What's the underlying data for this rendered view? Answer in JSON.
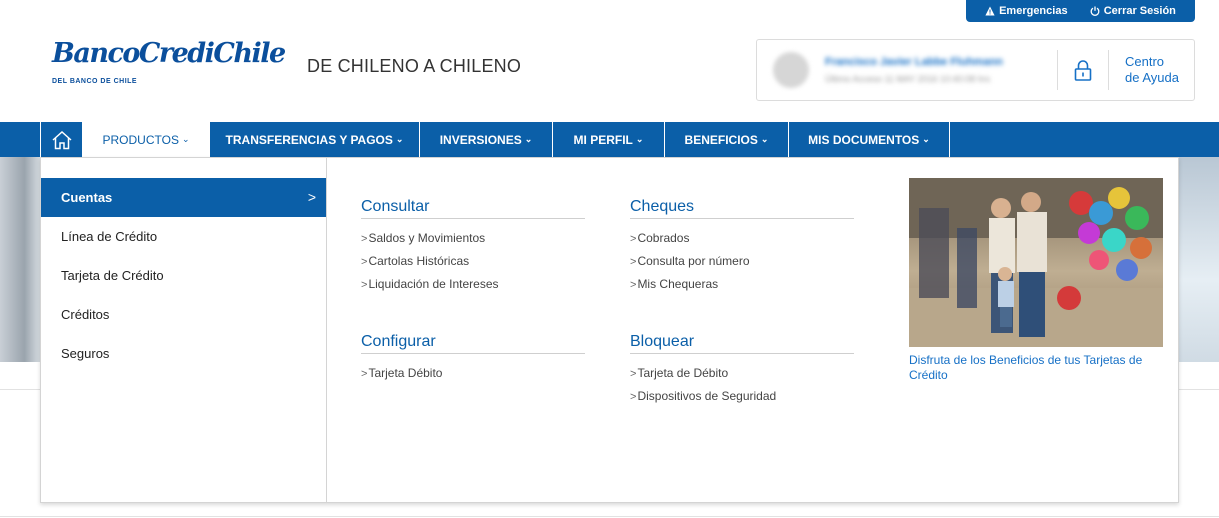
{
  "utility_bar": {
    "emergencias": "Emergencias",
    "cerrar_sesion": "Cerrar Sesión"
  },
  "logo": {
    "name": "BancoCrediChile",
    "sub": "DEL BANCO DE CHILE"
  },
  "tagline": "DE CHILENO A CHILENO",
  "user": {
    "name": "Francisco Javier Labbe Fluhmann",
    "last_access": "Último Acceso 11 MAY 2016 10:40:08 hrs"
  },
  "help": {
    "line1": "Centro",
    "line2": "de Ayuda"
  },
  "nav": {
    "items": [
      {
        "label": "PRODUCTOS"
      },
      {
        "label": "TRANSFERENCIAS Y PAGOS"
      },
      {
        "label": "INVERSIONES"
      },
      {
        "label": "MI PERFIL"
      },
      {
        "label": "BENEFICIOS"
      },
      {
        "label": "MIS DOCUMENTOS"
      }
    ],
    "chevron": "⌄"
  },
  "left_menu": {
    "items": [
      {
        "label": "Cuentas"
      },
      {
        "label": "Línea de Crédito"
      },
      {
        "label": "Tarjeta de Crédito"
      },
      {
        "label": "Créditos"
      },
      {
        "label": "Seguros"
      }
    ],
    "active_arrow": ">"
  },
  "sections": {
    "consultar": {
      "title": "Consultar",
      "links": [
        "Saldos y Movimientos",
        "Cartolas Históricas",
        "Liquidación de Intereses"
      ]
    },
    "cheques": {
      "title": "Cheques",
      "links": [
        "Cobrados",
        "Consulta por número",
        "Mis Chequeras"
      ]
    },
    "configurar": {
      "title": "Configurar",
      "links": [
        "Tarjeta Débito"
      ]
    },
    "bloquear": {
      "title": "Bloquear",
      "links": [
        "Tarjeta de Débito",
        "Dispositivos de Seguridad"
      ]
    }
  },
  "promo": {
    "caption": "Disfruta de los Beneficios de tus Tarjetas de Crédito"
  },
  "link_marker": ">",
  "colors": {
    "brand_blue": "#0b5fa8",
    "link_blue": "#1670c6"
  }
}
